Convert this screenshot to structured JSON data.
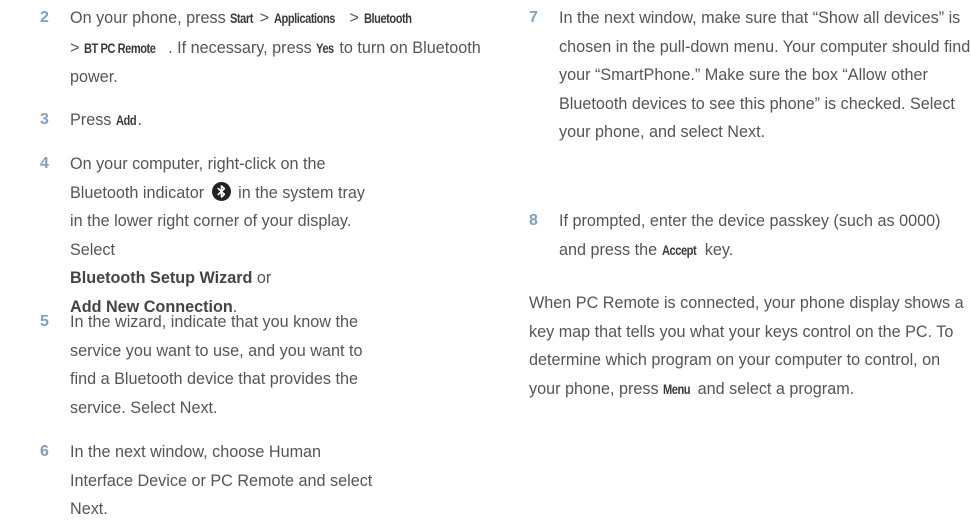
{
  "left_column": {
    "step2": {
      "number": "2",
      "t1": "On your phone, press ",
      "k1": "Start",
      "t2": " > ",
      "k2": "Applications",
      "t3": " > ",
      "k3": "Bluetooth",
      "t4": " > ",
      "k4": "BT PC Remote",
      "t5": ". If necessary, press ",
      "k5": "Yes",
      "t6": " to turn on Bluetooth power."
    },
    "step3": {
      "number": "3",
      "t1": "Press ",
      "k1": "Add",
      "t2": "."
    },
    "step4": {
      "number": "4",
      "t1": "On your computer, right-click on the Bluetooth indicator",
      "icon": "bluetooth-icon",
      "t2": "in the system tray in the lower right corner of your display. Select",
      "b1": "Bluetooth Setup Wizard",
      "t3": " or",
      "b2": "Add New Connection",
      "t4": "."
    },
    "step5": {
      "number": "5",
      "text": "In the wizard, indicate that you know the service you want to use, and you want to find a Bluetooth device that provides the service. Select Next."
    },
    "step6": {
      "number": "6",
      "text": "In the next window, choose Human Interface Device or PC Remote and select Next."
    }
  },
  "right_column": {
    "step7": {
      "number": "7",
      "text": "In the next window, make sure that “Show all devices” is chosen in the pull-down menu. Your computer should find your “SmartPhone.” Make sure the box “Allow other Bluetooth devices to see this phone” is checked. Select your phone, and select Next."
    },
    "step8": {
      "number": "8",
      "t1": "If prompted, enter the device passkey (such as 0000) and press the ",
      "k1": "Accept",
      "t2": " key."
    },
    "paragraph": {
      "t1": "When PC Remote is connected, your phone display shows a key map that tells you what your keys control on the PC. To determine which program on your computer to control, on your phone, press ",
      "k1": "Menu",
      "t2": " and select a program."
    }
  },
  "colors": {
    "step_number": "#7fa0bf",
    "body_text": "#555555"
  }
}
